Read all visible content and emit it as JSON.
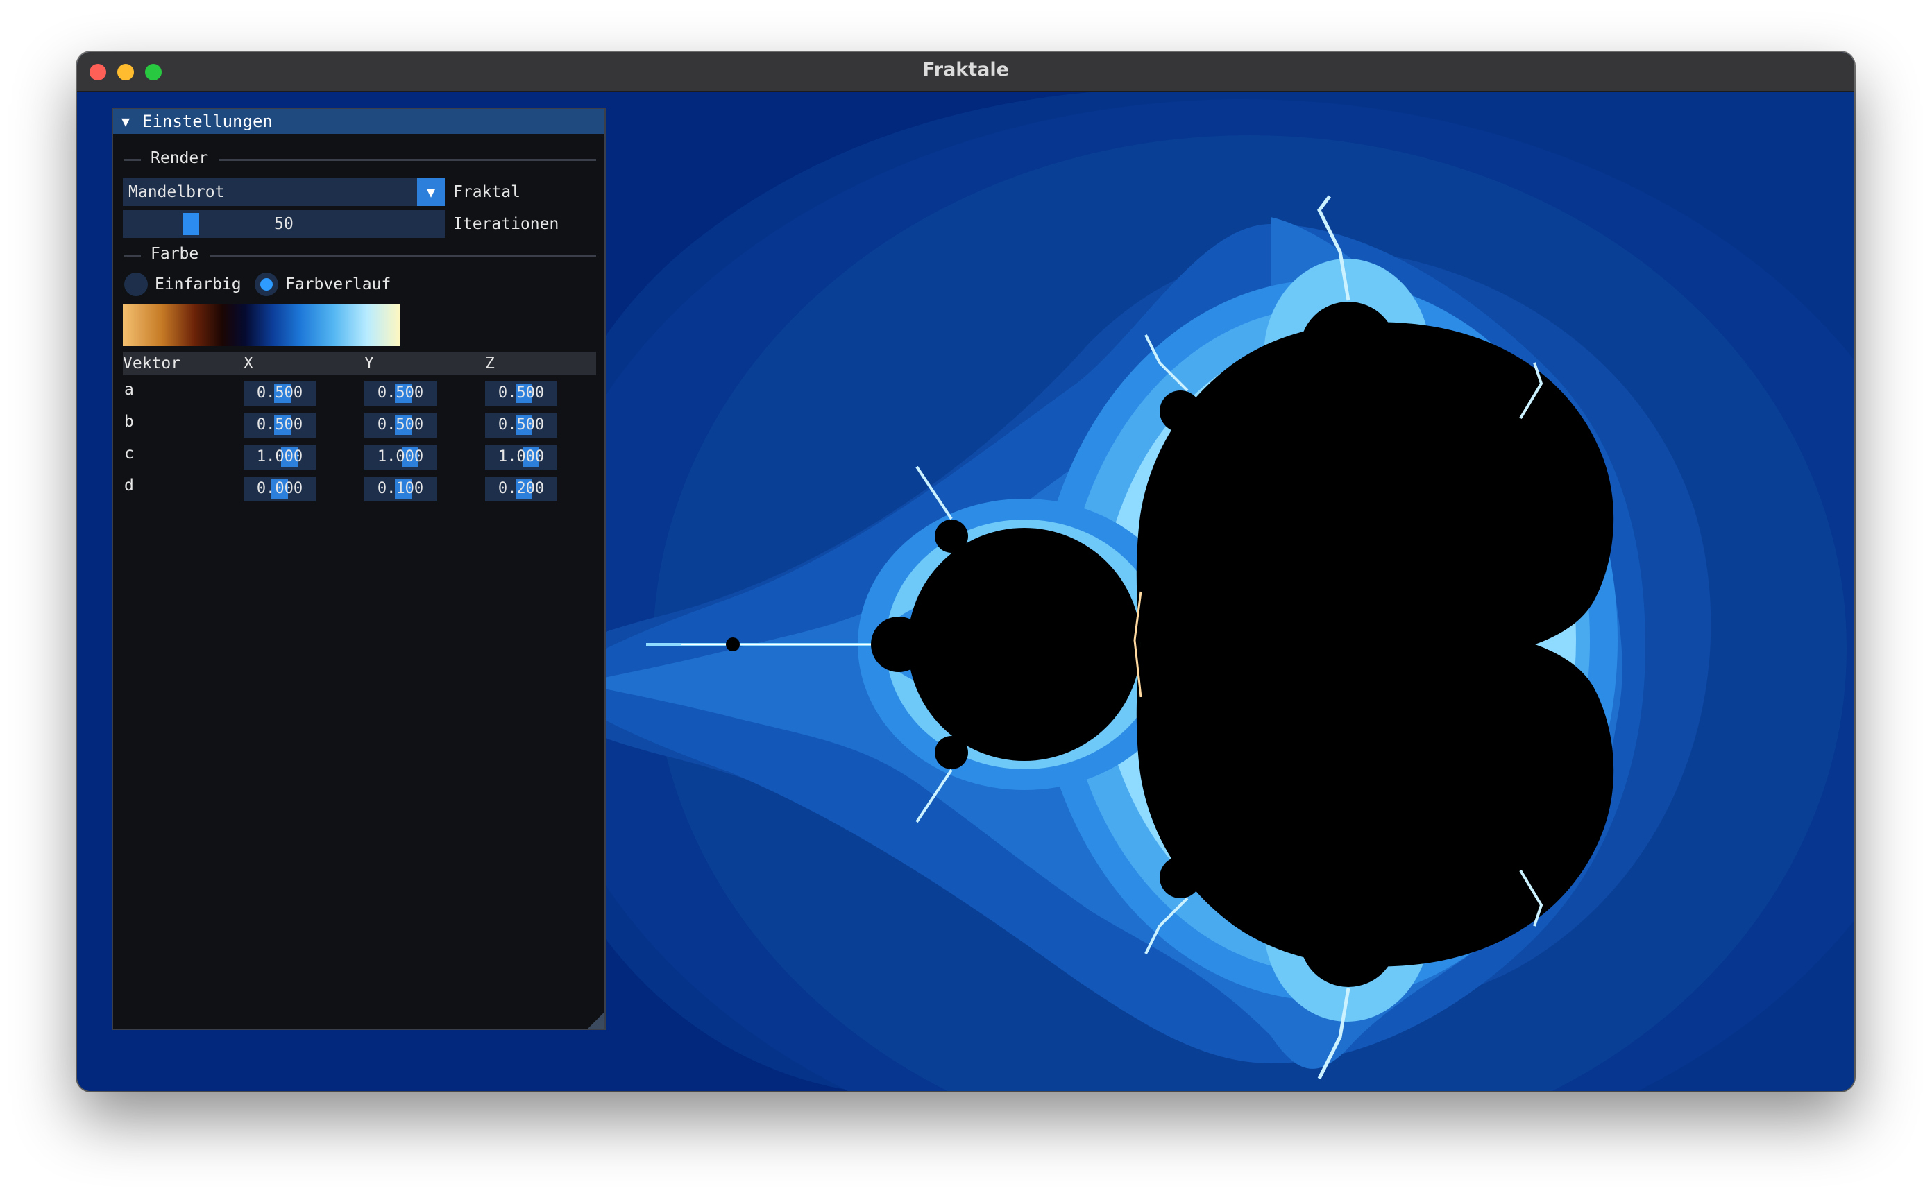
{
  "window": {
    "title": "Fraktale",
    "colors": {
      "titlebar": "#363638",
      "close": "#fe5f57",
      "minimize": "#febc2e",
      "maximize": "#28c840"
    }
  },
  "render_view": {
    "fractal": "Mandelbrot",
    "palette": [
      "#01287c",
      "#0a3f96",
      "#1466c8",
      "#2d8ce6",
      "#6ecbf5",
      "#ffffff",
      "#000000"
    ]
  },
  "panel": {
    "title": "Einstellungen",
    "render_section": {
      "label": "Render",
      "fractal_combo": {
        "value": "Mandelbrot",
        "label": "Fraktal"
      },
      "iterations": {
        "value": "50",
        "label": "Iterationen"
      }
    },
    "color_section": {
      "label": "Farbe",
      "radio_solid": "Einfarbig",
      "radio_gradient": "Farbverlauf",
      "selected": "Farbverlauf"
    },
    "vector_table": {
      "headers": [
        "Vektor",
        "X",
        "Y",
        "Z"
      ],
      "rows": [
        {
          "name": "a",
          "x": "0.500",
          "y": "0.500",
          "z": "0.500"
        },
        {
          "name": "b",
          "x": "0.500",
          "y": "0.500",
          "z": "0.500"
        },
        {
          "name": "c",
          "x": "1.000",
          "y": "1.000",
          "z": "1.000"
        },
        {
          "name": "d",
          "x": "0.000",
          "y": "0.100",
          "z": "0.200"
        }
      ]
    }
  }
}
